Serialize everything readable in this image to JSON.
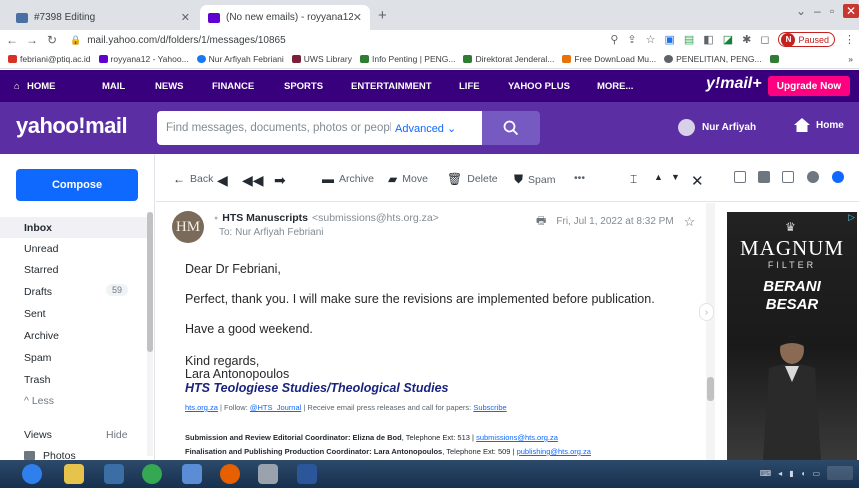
{
  "browser": {
    "tabs": [
      {
        "title": "#7398 Editing",
        "active": false
      },
      {
        "title": "(No new emails) - royyana12@y...",
        "active": true
      }
    ],
    "url": "mail.yahoo.com/d/folders/1/messages/10865",
    "profile_initial": "N",
    "paused_label": "Paused",
    "bookmarks": [
      "febriani@ptiq.ac.id",
      "royyana12 - Yahoo...",
      "Nur Arfiyah Febriani",
      "UWS Library",
      "Info Penting | PENG...",
      "Direktorat Jenderal...",
      "Free DownLoad Mu...",
      "PENELITIAN, PENG..."
    ]
  },
  "yahoo_nav": {
    "items": [
      "HOME",
      "MAIL",
      "NEWS",
      "FINANCE",
      "SPORTS",
      "ENTERTAINMENT",
      "LIFE",
      "YAHOO PLUS",
      "MORE..."
    ],
    "logo": "y!mail+",
    "upgrade_label": "Upgrade Now"
  },
  "header": {
    "logo": "yahoo!mail",
    "search_placeholder": "Find messages, documents, photos or people",
    "advanced_label": "Advanced",
    "user_name": "Nur Arfiyah",
    "home_label": "Home"
  },
  "sidebar": {
    "compose_label": "Compose",
    "folders": [
      {
        "label": "Inbox",
        "active": true
      },
      {
        "label": "Unread"
      },
      {
        "label": "Starred"
      },
      {
        "label": "Drafts",
        "count": "59"
      },
      {
        "label": "Sent"
      },
      {
        "label": "Archive"
      },
      {
        "label": "Spam"
      },
      {
        "label": "Trash"
      },
      {
        "label": "^ Less"
      }
    ],
    "views_label": "Views",
    "hide_label": "Hide",
    "photos_label": "Photos"
  },
  "toolbar": {
    "back": "Back",
    "archive": "Archive",
    "move": "Move",
    "delete": "Delete",
    "spam": "Spam",
    "more": "•••"
  },
  "message": {
    "avatar_initials": "HM",
    "sender_name": "HTS Manuscripts",
    "sender_email": "<submissions@hts.org.za>",
    "to": "To: Nur Arfiyah Febriani",
    "date": "Fri, Jul 1, 2022 at 8:32 PM",
    "greeting": "Dear Dr Febriani,",
    "paragraph1": "Perfect, thank you. I will make sure the revisions are implemented before publication.",
    "paragraph2": "Have a good weekend.",
    "closing": "Kind regards,",
    "signature_name": "Lara Antonopoulos",
    "signature_journal": "HTS Teologiese Studies/Theological Studies",
    "links_line": {
      "site": "hts.org.za",
      "follow": " | Follow: ",
      "twitter": "@HTS_Journal",
      "receive": " | Receive email press releases and call for papers: ",
      "subscribe": "Subscribe"
    },
    "coordinators": [
      {
        "role": "Submission and Review Editorial Coordinator: Elizna de Bod",
        "phone": ", Telephone Ext: 513 | ",
        "email": "submissions@hts.org.za"
      },
      {
        "role": "Finalisation and Publishing Production Coordinator: Lara Antonopoulos",
        "phone": ", Telephone Ext: 509 | ",
        "email": "publishing@hts.org.za"
      }
    ]
  },
  "ad": {
    "brand": "MAGNUM",
    "sub": "FILTER",
    "line1": "BERANI",
    "line2": "BESAR"
  },
  "colors": {
    "yahoo_nav_bg": "#39007d",
    "yahoo_header_bg": "#5b2ea3",
    "compose_bg": "#0f69ff",
    "upgrade_bg": "#ff0080"
  }
}
